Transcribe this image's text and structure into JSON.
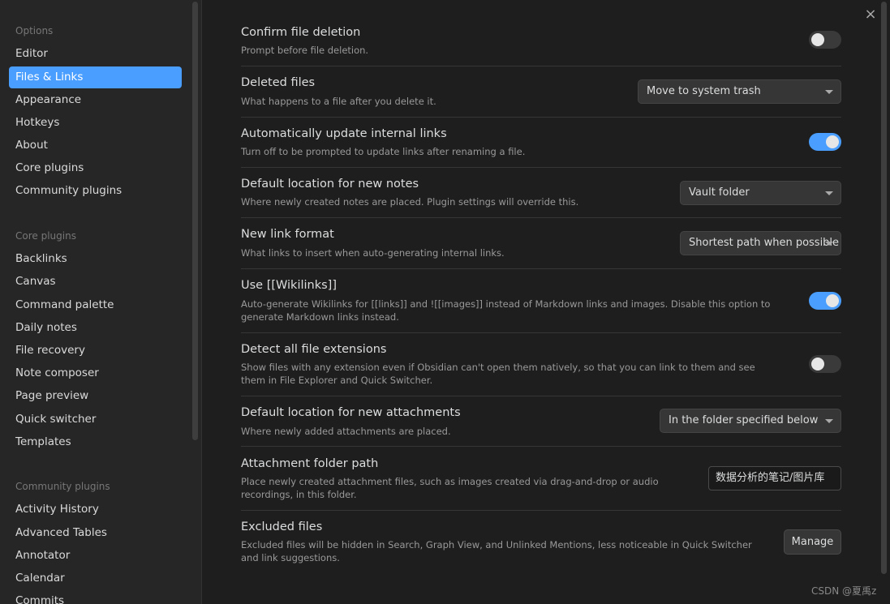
{
  "sidebar": {
    "options_title": "Options",
    "options": [
      "Editor",
      "Files & Links",
      "Appearance",
      "Hotkeys",
      "About",
      "Core plugins",
      "Community plugins"
    ],
    "core_title": "Core plugins",
    "core": [
      "Backlinks",
      "Canvas",
      "Command palette",
      "Daily notes",
      "File recovery",
      "Note composer",
      "Page preview",
      "Quick switcher",
      "Templates"
    ],
    "community_title": "Community plugins",
    "community": [
      "Activity History",
      "Advanced Tables",
      "Annotator",
      "Calendar",
      "Commits"
    ]
  },
  "settings": {
    "confirm_delete": {
      "title": "Confirm file deletion",
      "desc": "Prompt before file deletion.",
      "enabled": false
    },
    "deleted_files": {
      "title": "Deleted files",
      "desc": "What happens to a file after you delete it.",
      "value": "Move to system trash"
    },
    "auto_update_links": {
      "title": "Automatically update internal links",
      "desc": "Turn off to be prompted to update links after renaming a file.",
      "enabled": true
    },
    "default_location": {
      "title": "Default location for new notes",
      "desc": "Where newly created notes are placed. Plugin settings will override this.",
      "value": "Vault folder"
    },
    "link_format": {
      "title": "New link format",
      "desc": "What links to insert when auto-generating internal links.",
      "value": "Shortest path when possible"
    },
    "wikilinks": {
      "title": "Use [[Wikilinks]]",
      "desc": "Auto-generate Wikilinks for [[links]] and ![[images]] instead of Markdown links and images. Disable this option to generate Markdown links instead.",
      "enabled": true
    },
    "detect_extensions": {
      "title": "Detect all file extensions",
      "desc": "Show files with any extension even if Obsidian can't open them natively, so that you can link to them and see them in File Explorer and Quick Switcher.",
      "enabled": false
    },
    "attachment_location": {
      "title": "Default location for new attachments",
      "desc": "Where newly added attachments are placed.",
      "value": "In the folder specified below"
    },
    "attachment_path": {
      "title": "Attachment folder path",
      "desc": "Place newly created attachment files, such as images created via drag-and-drop or audio recordings, in this folder.",
      "value": "数据分析的笔记/图片库"
    },
    "excluded_files": {
      "title": "Excluded files",
      "desc": "Excluded files will be hidden in Search, Graph View, and Unlinked Mentions, less noticeable in Quick Switcher and link suggestions.",
      "button": "Manage"
    }
  },
  "close_icon": "×",
  "watermark": "CSDN @夏禹z",
  "colors": {
    "accent": "#4a9eff",
    "background": "#1e1e1e",
    "sidebar": "#262626"
  }
}
